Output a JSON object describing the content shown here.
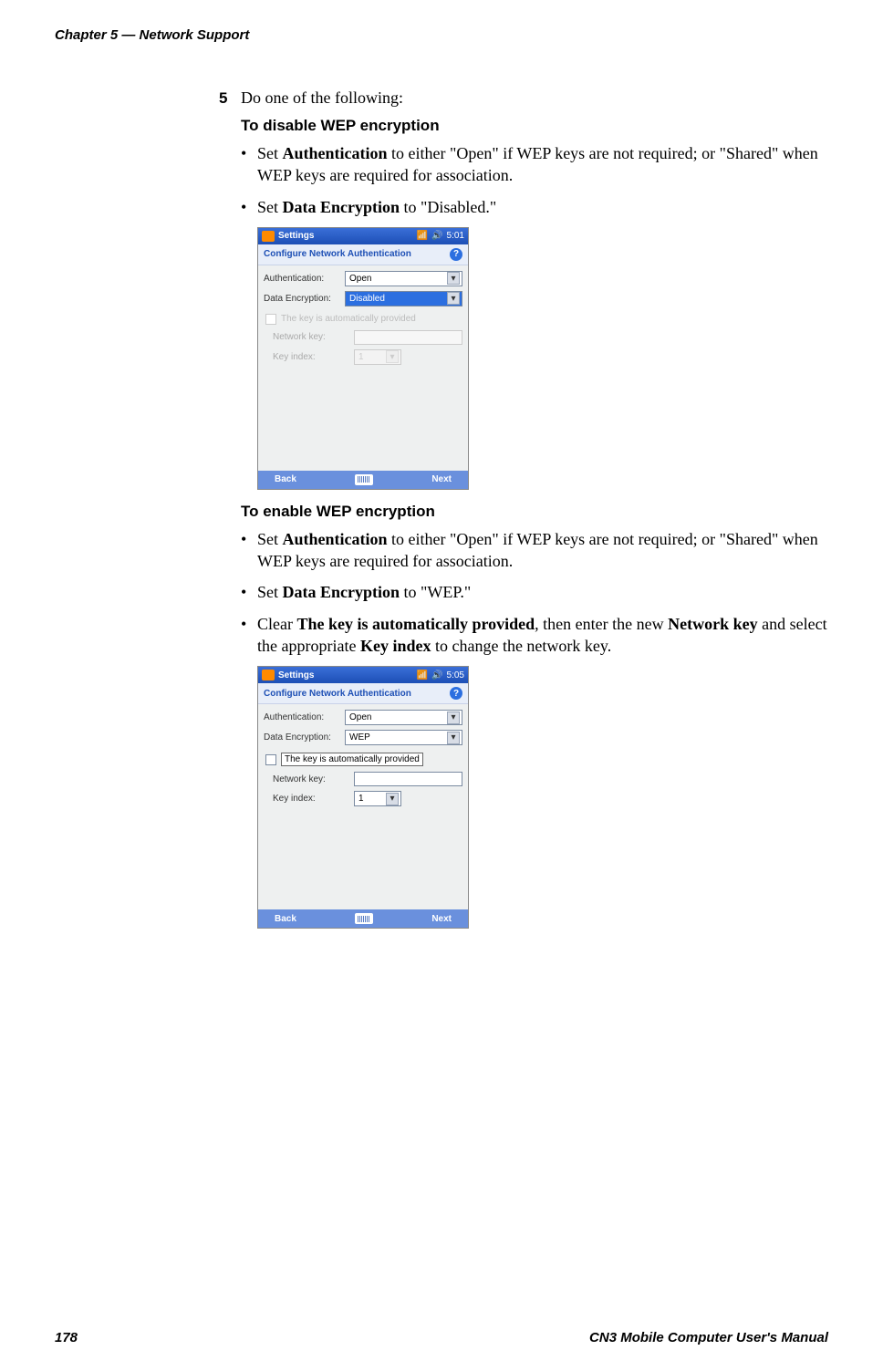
{
  "chapter": "Chapter 5 — Network Support",
  "page_number": "178",
  "footer_title": "CN3 Mobile Computer User's Manual",
  "step": {
    "num": "5",
    "text": "Do one of the following:"
  },
  "disable": {
    "heading": "To disable WEP encryption",
    "b1_pre": "Set ",
    "b1_bold": "Authentication",
    "b1_post": " to either \"Open\" if WEP keys are not required; or \"Shared\" when WEP keys are required for association.",
    "b2_pre": "Set ",
    "b2_bold": "Data Encryption",
    "b2_post": " to \"Disabled.\""
  },
  "enable": {
    "heading": "To enable WEP encryption",
    "b1_pre": "Set ",
    "b1_bold": "Authentication",
    "b1_post": " to either \"Open\" if WEP keys are not required; or \"Shared\" when WEP keys are required for association.",
    "b2_pre": "Set ",
    "b2_bold": "Data Encryption",
    "b2_post": " to \"WEP.\"",
    "b3_pre": "Clear ",
    "b3_bold1": "The key is automatically provided",
    "b3_mid1": ", then enter the new ",
    "b3_bold2": "Network key",
    "b3_mid2": " and select the appropriate ",
    "b3_bold3": "Key index",
    "b3_post": " to change the network key."
  },
  "ss1": {
    "titlebar": "Settings",
    "time": "5:01",
    "subtitle": "Configure Network Authentication",
    "auth_label": "Authentication:",
    "auth_value": "Open",
    "enc_label": "Data Encryption:",
    "enc_value": "Disabled",
    "chk_label": "The key is automatically provided",
    "netkey_label": "Network key:",
    "keyidx_label": "Key index:",
    "keyidx_value": "1",
    "back": "Back",
    "next": "Next"
  },
  "ss2": {
    "titlebar": "Settings",
    "time": "5:05",
    "subtitle": "Configure Network Authentication",
    "auth_label": "Authentication:",
    "auth_value": "Open",
    "enc_label": "Data Encryption:",
    "enc_value": "WEP",
    "chk_label": "The key is automatically provided",
    "netkey_label": "Network key:",
    "keyidx_label": "Key index:",
    "keyidx_value": "1",
    "back": "Back",
    "next": "Next"
  }
}
